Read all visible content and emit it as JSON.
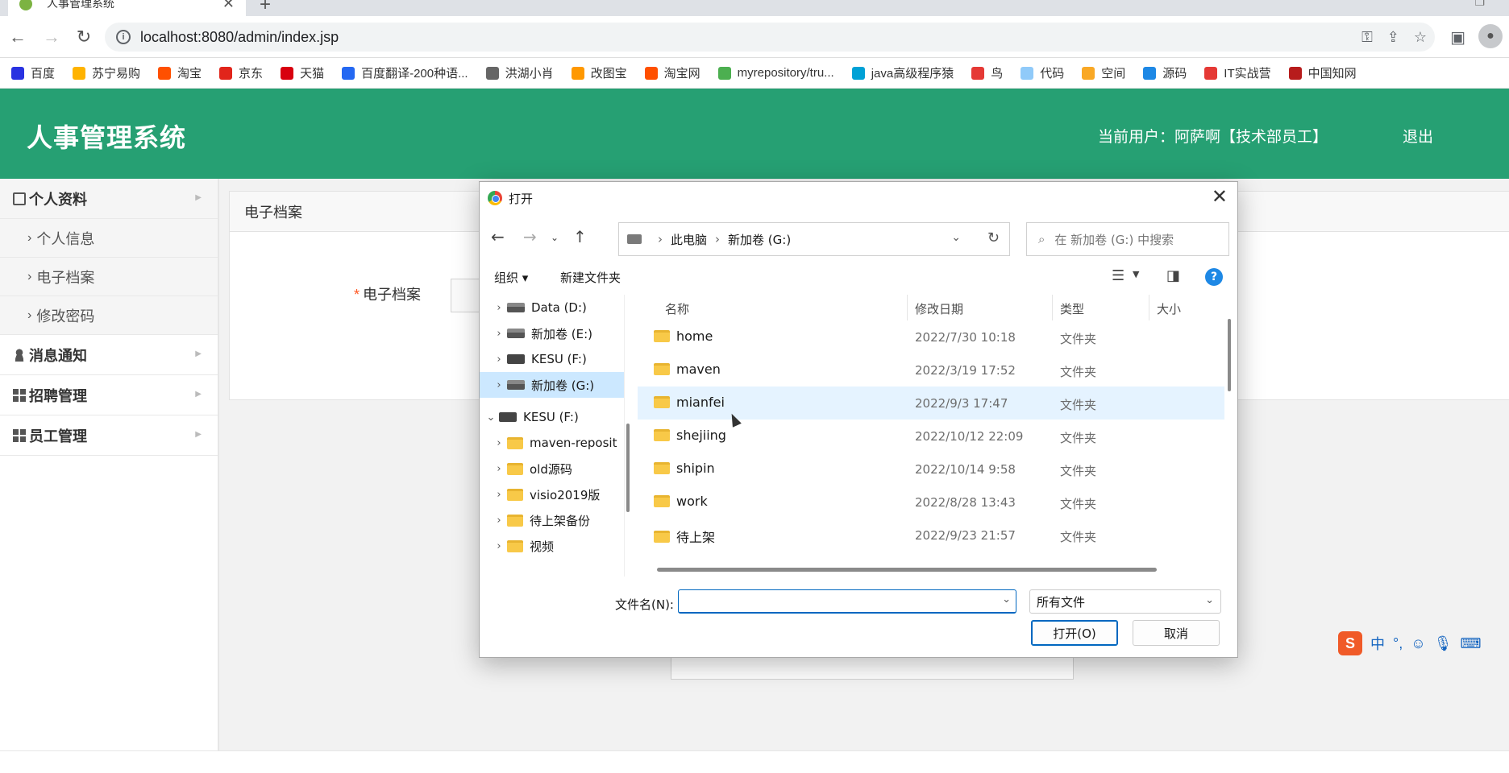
{
  "browser": {
    "tab_title": "人事管理系统",
    "url": "localhost:8080/admin/index.jsp",
    "bookmarks": [
      {
        "label": "百度",
        "color": "#2932e1"
      },
      {
        "label": "苏宁易购",
        "color": "#ffb300"
      },
      {
        "label": "淘宝",
        "color": "#ff5000"
      },
      {
        "label": "京东",
        "color": "#e1251b"
      },
      {
        "label": "天猫",
        "color": "#d8000f"
      },
      {
        "label": "百度翻译-200种语...",
        "color": "#2468f2"
      },
      {
        "label": "洪湖小肖",
        "color": "#666666"
      },
      {
        "label": "改图宝",
        "color": "#ff9800"
      },
      {
        "label": "淘宝网",
        "color": "#ff5000"
      },
      {
        "label": "myrepository/tru...",
        "color": "#4caf50"
      },
      {
        "label": "java高级程序猿",
        "color": "#00a1d6"
      },
      {
        "label": "鸟",
        "color": "#e53935"
      },
      {
        "label": "代码",
        "color": "#90caf9"
      },
      {
        "label": "空间",
        "color": "#f9a825"
      },
      {
        "label": "源码",
        "color": "#1e88e5"
      },
      {
        "label": "IT实战营",
        "color": "#e53935"
      },
      {
        "label": "中国知网",
        "color": "#b71c1c"
      }
    ]
  },
  "app": {
    "title": "人事管理系统",
    "user_info": "当前用户：阿萨啊【技术部员工】",
    "logout": "退出",
    "header_color": "#26a073"
  },
  "sidebar": {
    "groups": [
      {
        "label": "个人资料",
        "icon": "profile-icon",
        "items": [
          "个人信息",
          "电子档案",
          "修改密码"
        ]
      },
      {
        "label": "消息通知",
        "icon": "user-icon"
      },
      {
        "label": "招聘管理",
        "icon": "grid-icon"
      },
      {
        "label": "员工管理",
        "icon": "grid-icon"
      }
    ]
  },
  "main": {
    "panel_title": "电子档案",
    "field_label": "电子档案",
    "required_mark": "*"
  },
  "dialog": {
    "title": "打开",
    "path": [
      "此电脑",
      "新加卷 (G:)"
    ],
    "search_placeholder": "在 新加卷 (G:) 中搜索",
    "toolbar": {
      "organize": "组织 ▾",
      "new_folder": "新建文件夹"
    },
    "tree": [
      {
        "label": "Data (D:)",
        "type": "drive",
        "level": 1
      },
      {
        "label": "新加卷 (E:)",
        "type": "drive",
        "level": 1
      },
      {
        "label": "KESU  (F:)",
        "type": "drive",
        "level": 1
      },
      {
        "label": "新加卷 (G:)",
        "type": "drive",
        "level": 1,
        "selected": true
      },
      {
        "label": "KESU  (F:)",
        "type": "drive",
        "level": 0,
        "expanded": true
      },
      {
        "label": "maven-reposit",
        "type": "folder",
        "level": 1
      },
      {
        "label": "old源码",
        "type": "folder",
        "level": 1
      },
      {
        "label": "visio2019版",
        "type": "folder",
        "level": 1
      },
      {
        "label": "待上架备份",
        "type": "folder",
        "level": 1
      },
      {
        "label": "视频",
        "type": "folder",
        "level": 1
      }
    ],
    "columns": {
      "name": "名称",
      "date": "修改日期",
      "type": "类型",
      "size": "大小"
    },
    "files": [
      {
        "name": "home",
        "date": "2022/7/30 10:18",
        "type": "文件夹"
      },
      {
        "name": "maven",
        "date": "2022/3/19 17:52",
        "type": "文件夹"
      },
      {
        "name": "mianfei",
        "date": "2022/9/3 17:47",
        "type": "文件夹",
        "hover": true
      },
      {
        "name": "shejiing",
        "date": "2022/10/12 22:09",
        "type": "文件夹"
      },
      {
        "name": "shipin",
        "date": "2022/10/14 9:58",
        "type": "文件夹"
      },
      {
        "name": "work",
        "date": "2022/8/28 13:43",
        "type": "文件夹"
      },
      {
        "name": "待上架",
        "date": "2022/9/23 21:57",
        "type": "文件夹"
      }
    ],
    "filename_label": "文件名(N):",
    "filename_value": "",
    "filetype": "所有文件",
    "open_button": "打开(O)",
    "cancel_button": "取消"
  },
  "ime": {
    "label": "中",
    "punct": "°,"
  }
}
